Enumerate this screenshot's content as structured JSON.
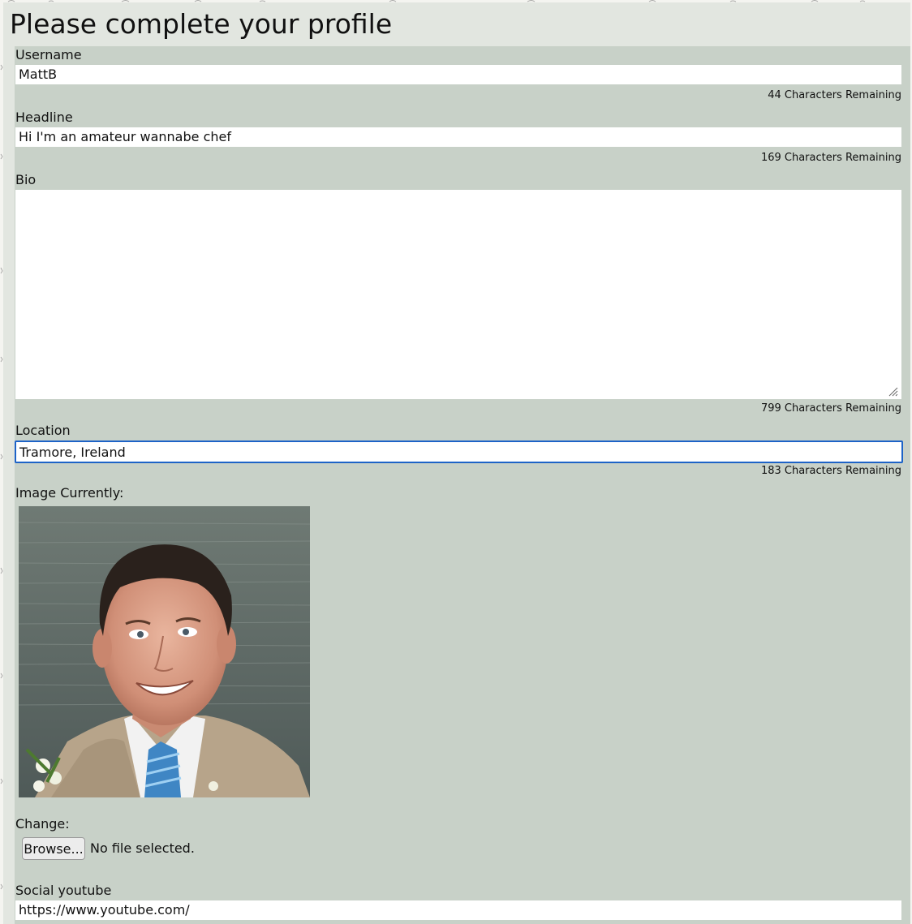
{
  "page": {
    "title": "Please complete your profile"
  },
  "form": {
    "username": {
      "label": "Username",
      "value": "MattB",
      "counter": "44 Characters Remaining"
    },
    "headline": {
      "label": "Headline",
      "value": "Hi I'm an amateur wannabe chef",
      "counter": "169 Characters Remaining"
    },
    "bio": {
      "label": "Bio",
      "value": "",
      "counter": "799 Characters Remaining"
    },
    "location": {
      "label": "Location",
      "value": "Tramore, Ireland",
      "counter": "183 Characters Remaining"
    },
    "image": {
      "label": "Image Currently:",
      "change_label": "Change:",
      "browse_label": "Browse...",
      "file_status": "No file selected."
    },
    "social_youtube": {
      "label": "Social youtube",
      "value": "https://www.youtube.com/"
    }
  },
  "colors": {
    "page_background": "#e2e6e0",
    "form_background": "#c8d1c8",
    "focus_outline": "#1d63c7"
  },
  "icons": [
    "resize-grip-icon"
  ]
}
